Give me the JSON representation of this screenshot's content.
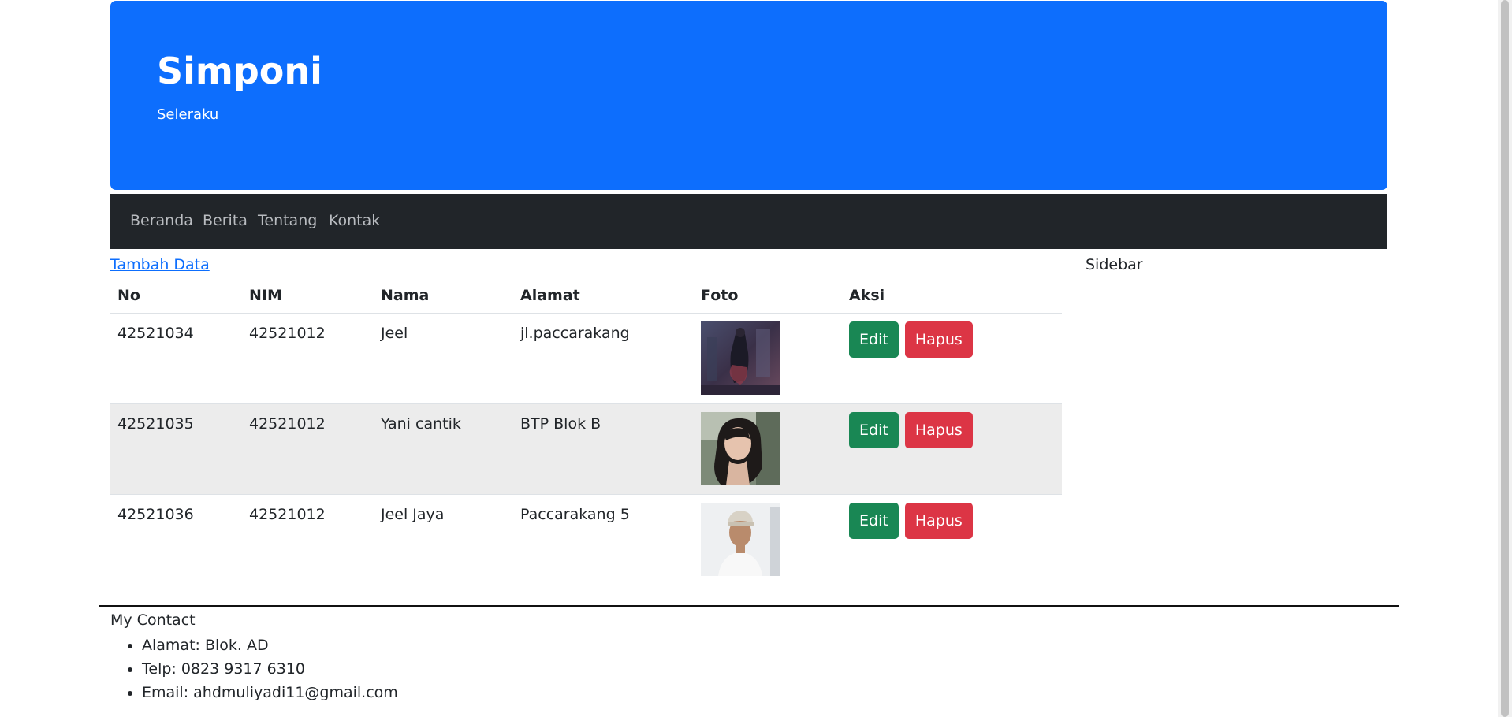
{
  "header": {
    "title": "Simponi",
    "subtitle": "Seleraku"
  },
  "nav": {
    "items": [
      "Beranda",
      "Berita",
      "Tentang",
      "Kontak"
    ]
  },
  "main": {
    "add_link": "Tambah Data",
    "table": {
      "columns": [
        "No",
        "NIM",
        "Nama",
        "Alamat",
        "Foto",
        "Aksi"
      ],
      "rows": [
        {
          "no": "42521034",
          "nim": "42521012",
          "nama": "Jeel",
          "alamat": "jl.paccarakang",
          "photo": "dark-figure-photo",
          "edit": "Edit",
          "hapus": "Hapus"
        },
        {
          "no": "42521035",
          "nim": "42521012",
          "nama": "Yani cantik",
          "alamat": "BTP Blok B",
          "photo": "woman-portrait-photo",
          "edit": "Edit",
          "hapus": "Hapus"
        },
        {
          "no": "42521036",
          "nim": "42521012",
          "nama": "Jeel Jaya",
          "alamat": "Paccarakang 5",
          "photo": "man-cap-portrait-photo",
          "edit": "Edit",
          "hapus": "Hapus"
        }
      ]
    }
  },
  "sidebar": {
    "label": "Sidebar"
  },
  "footer": {
    "title": "My Contact",
    "items": [
      "Alamat: Blok. AD",
      "Telp: 0823 9317 6310",
      "Email: ahdmuliyadi11@gmail.com"
    ]
  },
  "colors": {
    "primary": "#0d6efd",
    "navbar": "#212529",
    "success": "#198754",
    "danger": "#dc3545"
  }
}
